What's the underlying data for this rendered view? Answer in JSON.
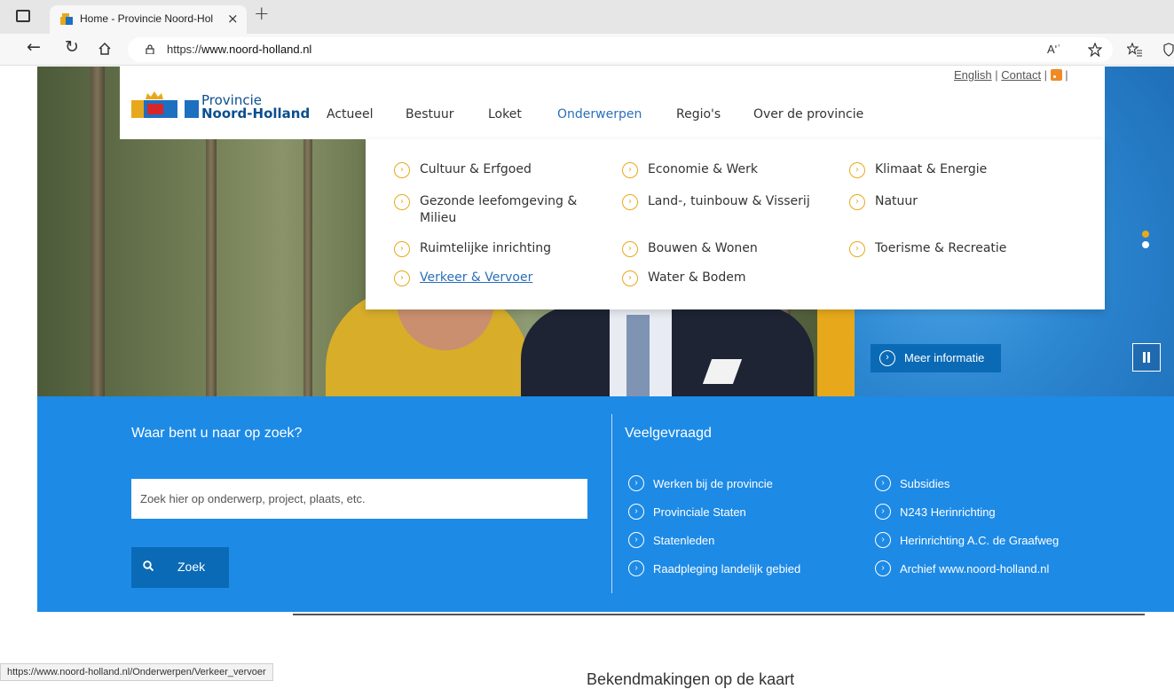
{
  "browser": {
    "tab_title": "Home - Provincie Noord-Holland",
    "tab_close": "×",
    "new_tab": "+",
    "url_prefix": "https://",
    "url_domain": "www.noord-holland.nl",
    "read_aloud": "Aʹʾ",
    "status_url": "https://www.noord-holland.nl/Onderwerpen/Verkeer_vervoer"
  },
  "header": {
    "logo_line1": "Provincie",
    "logo_line2": "Noord-Holland",
    "top_links": [
      "English",
      "Contact"
    ],
    "nav": [
      "Actueel",
      "Bestuur",
      "Loket",
      "Onderwerpen",
      "Regio's",
      "Over de provincie"
    ],
    "active_nav": "Onderwerpen"
  },
  "dropdown": {
    "col1": [
      "Cultuur & Erfgoed",
      "Gezonde leefomgeving &",
      "Milieu",
      "Ruimtelijke inrichting",
      "Verkeer & Vervoer"
    ],
    "col2": [
      "Economie & Werk",
      "Land-, tuinbouw & Visserij",
      "Bouwen & Wonen",
      "Water & Bodem"
    ],
    "col3": [
      "Klimaat & Energie",
      "Natuur",
      "Toerisme & Recreatie"
    ],
    "active_item": "Verkeer & Vervoer"
  },
  "hero": {
    "meer_label": "Meer informatie"
  },
  "search": {
    "title": "Waar bent u naar op zoek?",
    "placeholder": "Zoek hier op onderwerp, project, plaats, etc.",
    "button": "Zoek"
  },
  "faq": {
    "title": "Veelgevraagd",
    "col1": [
      "Werken bij de provincie",
      "Provinciale Staten",
      "Statenleden",
      "Raadpleging landelijk gebied"
    ],
    "col2": [
      "Subsidies",
      "N243 Herinrichting",
      "Herinrichting A.C. de Graafweg",
      "Archief www.noord-holland.nl"
    ]
  },
  "footer": {
    "bekend": "Bekendmakingen op de kaart"
  },
  "colors": {
    "brand_blue": "#1d8ae6",
    "dark_blue": "#0a6ab6",
    "accent_yellow": "#e7a91b",
    "nav_active": "#2a6fb8"
  }
}
